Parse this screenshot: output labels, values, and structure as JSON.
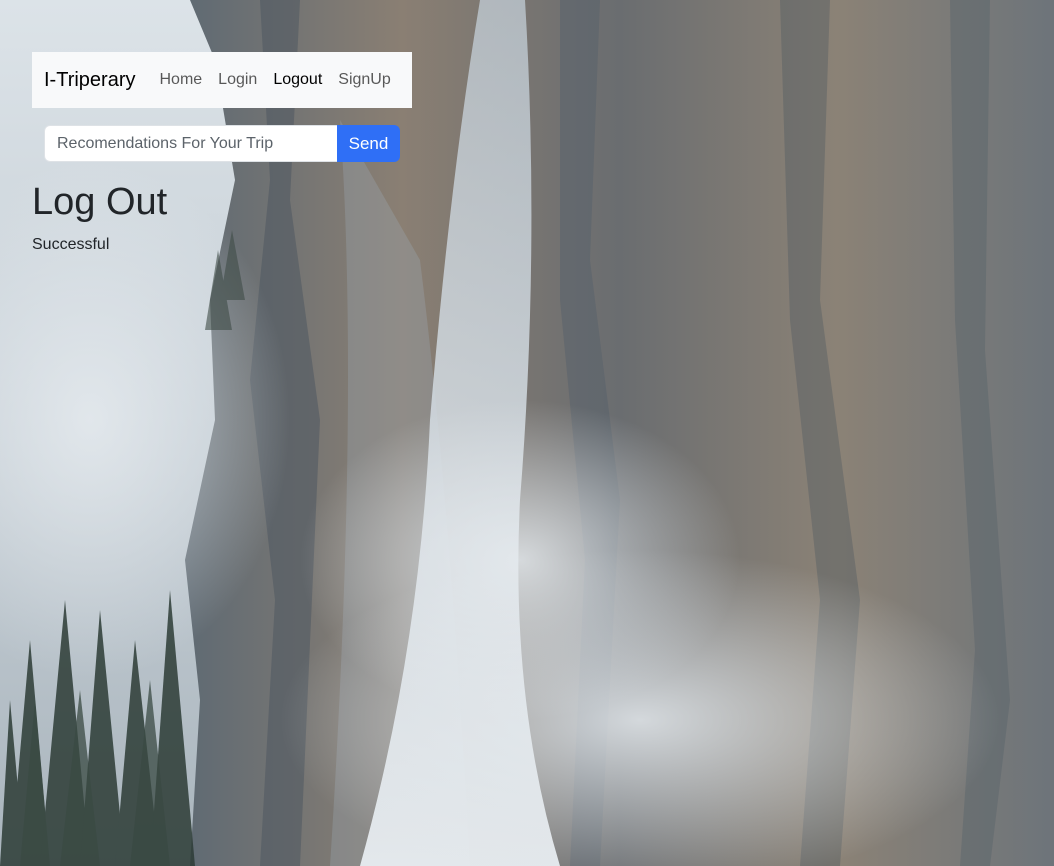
{
  "navbar": {
    "brand": "I-Triperary",
    "links": [
      {
        "label": "Home",
        "active": false
      },
      {
        "label": "Login",
        "active": false
      },
      {
        "label": "Logout",
        "active": true
      },
      {
        "label": "SignUp",
        "active": false
      }
    ]
  },
  "search": {
    "placeholder": "Recomendations For Your Trip",
    "value": "",
    "button_label": "Send"
  },
  "main": {
    "title": "Log Out",
    "status": "Successful"
  },
  "colors": {
    "primary": "#2f6ff6",
    "navbar_bg": "#f8f9fa",
    "text": "#212529"
  },
  "background": {
    "icon": "waterfall-cliff-photo"
  }
}
